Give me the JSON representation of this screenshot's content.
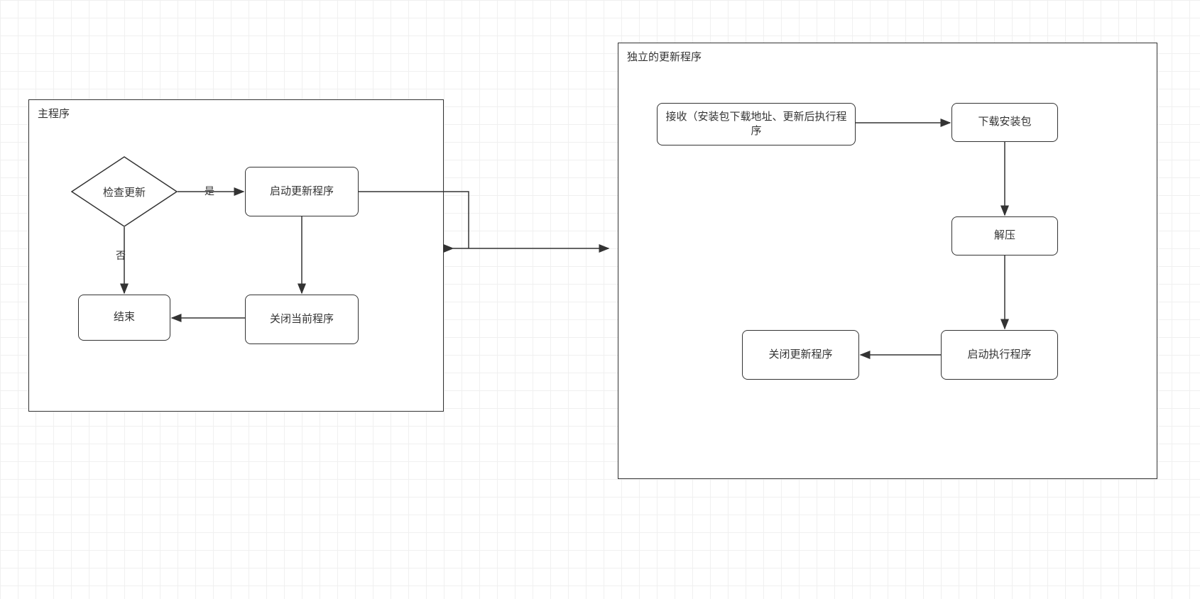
{
  "containers": {
    "main": {
      "title": "主程序"
    },
    "updater": {
      "title": "独立的更新程序"
    }
  },
  "nodes": {
    "check_update": "检查更新",
    "start_updater": "启动更新程序",
    "end": "结束",
    "close_current": "关闭当前程序",
    "receive": "接收（安装包下载地址、更新后执行程序",
    "download": "下载安装包",
    "extract": "解压",
    "start_exec": "启动执行程序",
    "close_updater": "关闭更新程序"
  },
  "edges": {
    "yes": "是",
    "no": "否"
  }
}
